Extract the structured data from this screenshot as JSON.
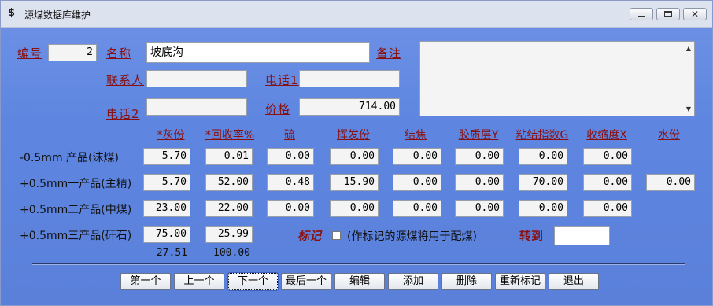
{
  "window": {
    "title": "源煤数据库维护",
    "app_icon": "dollar-icon",
    "controls": {
      "minimize": "minimize-icon",
      "maximize": "maximize-icon",
      "close": "✕"
    }
  },
  "form": {
    "id_label": "编号",
    "id_value": "2",
    "name_label": "名称",
    "name_value": "坡底沟",
    "notes_label": "备注",
    "notes_value": "",
    "contact_label": "联系人",
    "contact_value": "",
    "phone1_label": "电话1",
    "phone1_value": "",
    "phone2_label": "电话2",
    "phone2_value": "",
    "price_label": "价格",
    "price_value": "714.00"
  },
  "grid": {
    "headers": [
      "*灰份",
      "*回收率%",
      "硫",
      "挥发份",
      "结焦",
      "胶质层Y",
      "粘结指数G",
      "收缩度X",
      "水份"
    ],
    "rows": [
      {
        "label": "-0.5mm  产品(沫煤)",
        "values": [
          "5.70",
          "0.01",
          "0.00",
          "0.00",
          "0.00",
          "0.00",
          "0.00",
          "0.00"
        ]
      },
      {
        "label": "+0.5mm一产品(主精)",
        "values": [
          "5.70",
          "52.00",
          "0.48",
          "15.90",
          "0.00",
          "0.00",
          "70.00",
          "0.00",
          "0.00"
        ]
      },
      {
        "label": "+0.5mm二产品(中煤)",
        "values": [
          "23.00",
          "22.00",
          "0.00",
          "0.00",
          "0.00",
          "0.00",
          "0.00",
          "0.00"
        ]
      },
      {
        "label": "+0.5mm三产品(矸石)",
        "values": [
          "75.00",
          "25.99"
        ]
      }
    ],
    "totals": [
      "27.51",
      "100.00"
    ]
  },
  "mark": {
    "label": "标记",
    "checked": false,
    "note": "(作标记的源煤将用于配煤)",
    "goto_label": "转到",
    "goto_value": ""
  },
  "buttons": {
    "first": "第一个",
    "prev": "上一个",
    "next": "下一个",
    "last": "最后一个",
    "edit": "编辑",
    "add": "添加",
    "delete": "删除",
    "remark": "重新标记",
    "exit": "退出"
  }
}
